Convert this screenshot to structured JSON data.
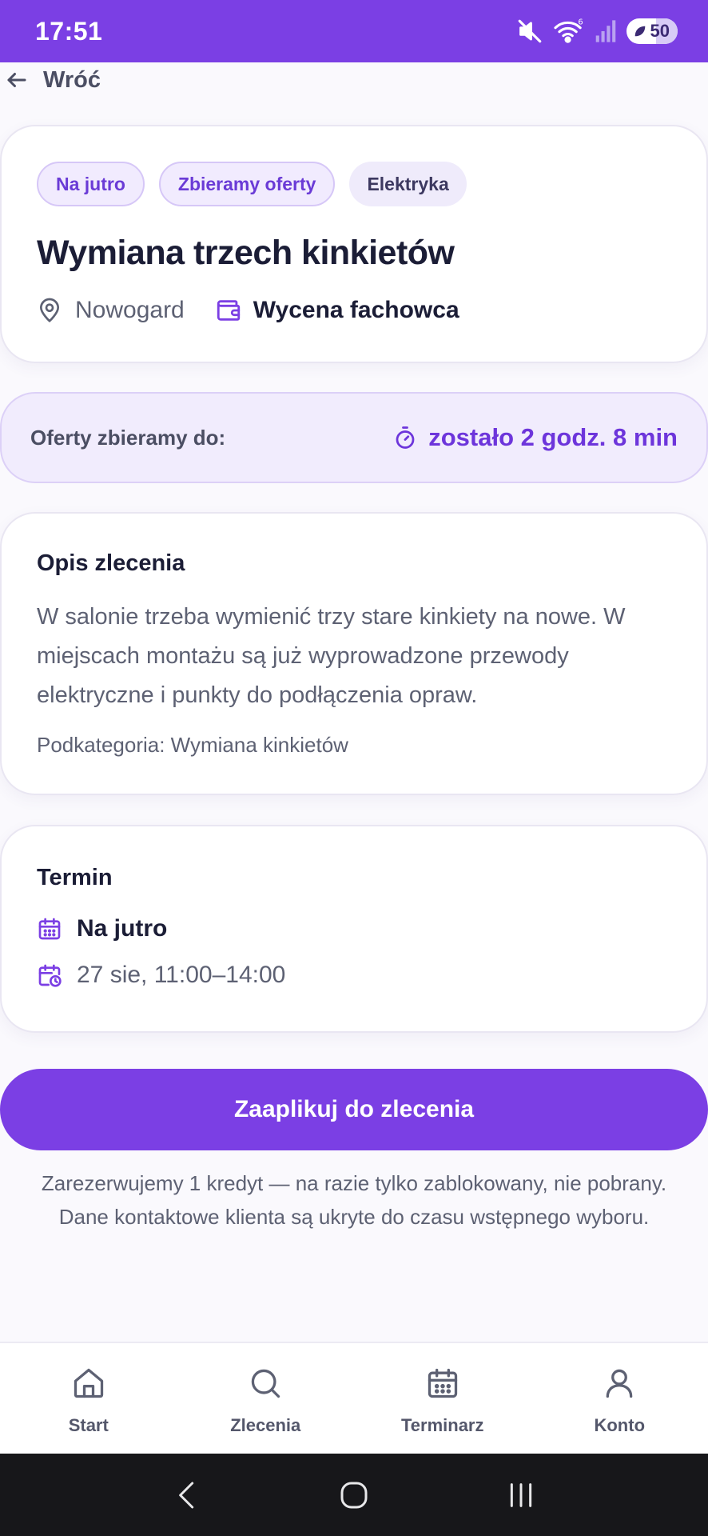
{
  "status_bar": {
    "time": "17:51",
    "battery": "50"
  },
  "nav": {
    "back_label": "Wróć"
  },
  "job": {
    "chips": [
      "Na jutro",
      "Zbieramy oferty",
      "Elektryka"
    ],
    "title": "Wymiana trzech kinkietów",
    "location": "Nowogard",
    "pricing": "Wycena fachowca"
  },
  "deadline": {
    "label": "Oferty zbieramy do:",
    "remaining": "zostało 2 godz. 8 min"
  },
  "description": {
    "heading": "Opis zlecenia",
    "body": "W salonie trzeba wymienić trzy stare kinkiety na nowe. W miejscach montażu są już wyprowadzone przewody elektryczne i punkty do podłączenia opraw.",
    "subcategory": "Podkategoria: Wymiana kinkietów"
  },
  "term": {
    "heading": "Termin",
    "when": "Na jutro",
    "slot": "27 sie, 11:00–14:00"
  },
  "cta": {
    "label": "Zaaplikuj do zlecenia",
    "note_line1": "Zarezerwujemy 1 kredyt — na razie tylko zablokowany, nie pobrany.",
    "note_line2": "Dane kontaktowe klienta są ukryte do czasu wstępnego wyboru."
  },
  "tabs": [
    {
      "label": "Start",
      "icon": "home-icon"
    },
    {
      "label": "Zlecenia",
      "icon": "search-icon"
    },
    {
      "label": "Terminarz",
      "icon": "calendar-icon"
    },
    {
      "label": "Konto",
      "icon": "user-icon"
    }
  ],
  "colors": {
    "accent": "#7b3fe4",
    "accent_text": "#6d35db"
  }
}
